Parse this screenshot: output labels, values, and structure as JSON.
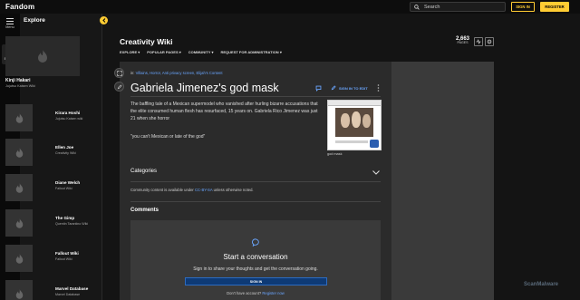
{
  "header": {
    "logo_text": "Fandom",
    "search_placeholder": "Search",
    "sign_in": "SIGN IN",
    "register": "REGISTER"
  },
  "rail": {
    "menu_label": "Menu",
    "explore_label": "Explore"
  },
  "explore": {
    "title": "Explore",
    "cards": [
      {
        "name": "Kinji Hakari",
        "sub": "Jujutsu Kaisen Wiki"
      },
      {
        "name": "Kirara Hoshi",
        "sub": "Jujutsu Kaisen wiki"
      },
      {
        "name": "Ellen Joe",
        "sub": "Creativity Wiki"
      },
      {
        "name": "Diane Welch",
        "sub": "Fallout Wiki"
      },
      {
        "name": "The Gimp",
        "sub": "Quentin Tarantino Wiki"
      },
      {
        "name": "Fallout Wiki",
        "sub": "Fallout Wiki"
      },
      {
        "name": "Marvel Database",
        "sub": "Marvel Database"
      }
    ]
  },
  "wiki": {
    "title": "Creativity Wiki",
    "nav": [
      "EXPLORE",
      "POPULAR PAGES",
      "COMMUNITY",
      "REQUEST FOR ADMINISTRATION"
    ],
    "pages_count": "2,663",
    "pages_label": "PAGES"
  },
  "article": {
    "in_label": "in:",
    "categories": "Villains, Horror, Anti privacy screen, Elijah's Content",
    "title": "Gabriela Jimenez's god mask",
    "edit_label": "SIGN IN TO EDIT",
    "para1": "The baffling tale of a Mexican supermodel who vanished after hurling bizarre accusations that the elite consumed human flesh has resurfaced, 15 years on. Gabriela Rico Jimenez was just 21 when she horror",
    "para2": "\"you can't Mexican or late of the god\"",
    "caption": "god mask",
    "categories_heading": "Categories",
    "license_prefix": "Community content is available under",
    "license_link": "CC-BY-SA",
    "license_suffix": "unless otherwise noted.",
    "comments_heading": "Comments"
  },
  "conversation": {
    "title": "Start a conversation",
    "subtitle": "Sign in to share your thoughts and get the conversation going.",
    "button": "SIGN IN",
    "account_prefix": "Don't have account?",
    "account_link": "Register now"
  },
  "watermark": "ScanMalware",
  "colors": {
    "accent": "#ffcc33",
    "link": "#6aa6ff",
    "button_blue": "#0e3a75"
  }
}
